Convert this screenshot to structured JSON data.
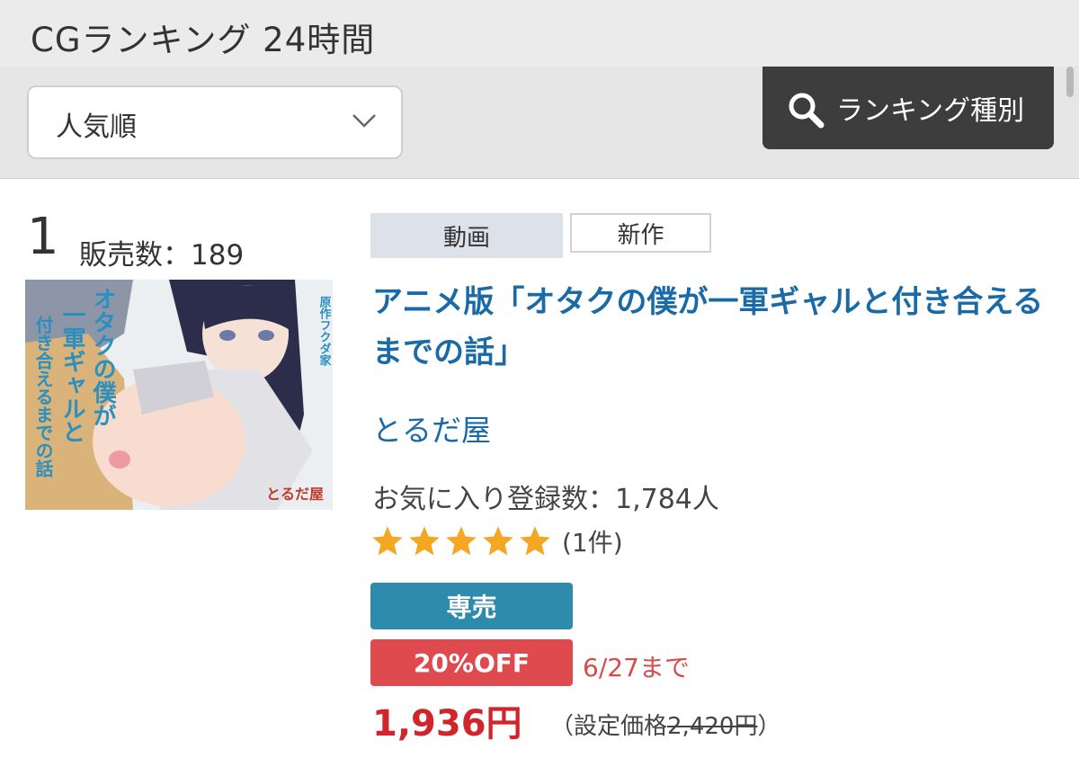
{
  "header": {
    "title": "CGランキング 24時間"
  },
  "controls": {
    "sort_label": "人気順",
    "ranking_type_label": "ランキング種別"
  },
  "item": {
    "rank": "1",
    "sales_label": "販売数：189",
    "tags": {
      "video": "動画",
      "new": "新作"
    },
    "title": "アニメ版「オタクの僕が一軍ギャルと付き合えるまでの話」",
    "circle": "とるだ屋",
    "favorites": "お気に入り登録数：1,784人",
    "rating": 5,
    "rating_count": "(1件)",
    "exclusive_label": "専売",
    "discount_label": "20%OFF",
    "discount_until": "6/27まで",
    "price": "1,936円",
    "list_price_prefix": "（設定価格",
    "list_price_value": "2,420円",
    "list_price_suffix": "）",
    "thumbnail": {
      "logo_text": "とるだ屋",
      "vertical_title": "原作フクダ家",
      "line1": "オタクの僕が",
      "line2": "一軍ギャルと",
      "line3": "付き合えるまでの話"
    }
  },
  "colors": {
    "link": "#1a6aa8",
    "exclusive": "#2f8bac",
    "discount": "#df4a4f",
    "price": "#d0262b",
    "star": "#f5a623"
  }
}
